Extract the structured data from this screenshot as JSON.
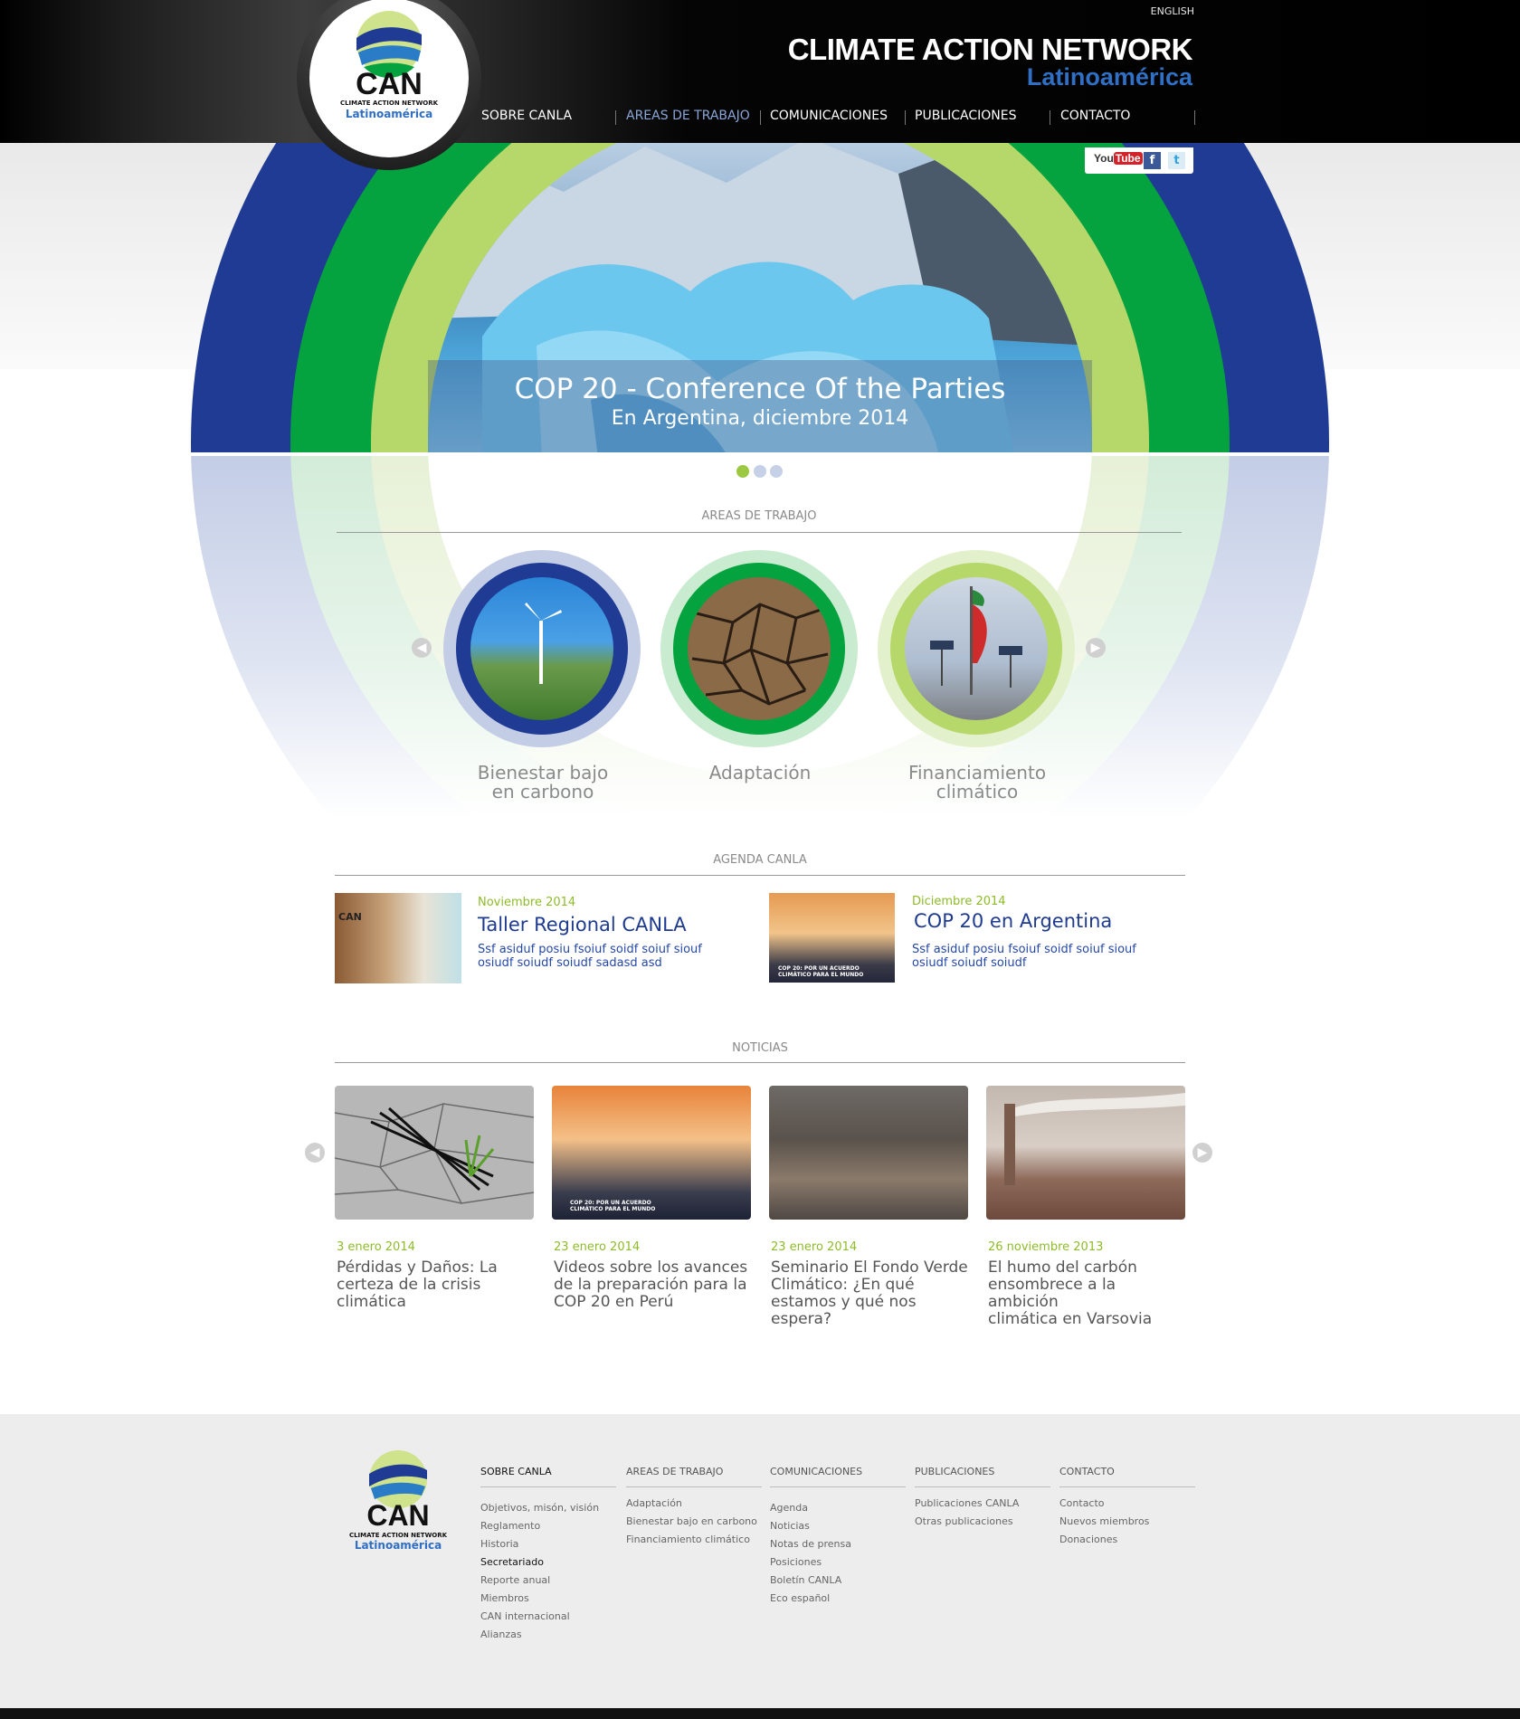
{
  "header": {
    "language_link": "ENGLISH",
    "brand_title": "CLIMATE ACTION NETWORK",
    "brand_subtitle": "Latinoamérica",
    "logo_text": "CAN",
    "logo_line1": "CLIMATE ACTION NETWORK",
    "logo_line2": "Latinoamérica",
    "nav": [
      {
        "label": "SOBRE CANLA",
        "active": false
      },
      {
        "label": "AREAS DE TRABAJO",
        "active": true
      },
      {
        "label": "COMUNICACIONES",
        "active": false
      },
      {
        "label": "PUBLICACIONES",
        "active": false
      },
      {
        "label": "CONTACTO",
        "active": false
      }
    ]
  },
  "social": {
    "youtube": "YouTube",
    "facebook": "f",
    "twitter": "t"
  },
  "hero": {
    "title": "COP 20 - Conference Of the Parties",
    "subtitle": "En Argentina, diciembre 2014",
    "slides": 3,
    "active_slide": 1
  },
  "areas": {
    "section_title": "AREAS DE TRABAJO",
    "items": [
      {
        "label_line1": "Bienestar bajo",
        "label_line2": "en carbono"
      },
      {
        "label_line1": "Adaptación",
        "label_line2": ""
      },
      {
        "label_line1": "Financiamiento",
        "label_line2": "climático"
      }
    ]
  },
  "agenda": {
    "section_title": "AGENDA CANLA",
    "items": [
      {
        "date": "Noviembre 2014",
        "title": "Taller Regional CANLA",
        "text_line1": "Ssf asiduf posiu fsoiuf soidf soiuf siouf",
        "text_line2": "osiudf soiudf soiudf sadasd asd",
        "image_caption": "CAN"
      },
      {
        "date": "Diciembre 2014",
        "title": "COP 20 en Argentina",
        "text_line1": "Ssf asiduf posiu fsoiuf soidf soiuf siouf",
        "text_line2": "osiudf soiudf soiudf",
        "image_caption": "COP 20: POR UN ACUERDO CLIMÁTICO PARA EL MUNDO"
      }
    ]
  },
  "news": {
    "section_title": "NOTICIAS",
    "items": [
      {
        "date": "3 enero 2014",
        "title_line1": "Pérdidas y Daños: La",
        "title_line2": "certeza de la crisis",
        "title_line3": "climática"
      },
      {
        "date": "23 enero 2014",
        "title_line1": "Videos sobre los avances",
        "title_line2": "de la preparación para la",
        "title_line3": "COP 20 en Perú",
        "image_caption": "COP 20: POR UN ACUERDO CLIMÁTICO PARA EL MUNDO"
      },
      {
        "date": "23 enero 2014",
        "title_line1": "Seminario El Fondo Verde",
        "title_line2": "Climático: ¿En qué",
        "title_line3": "estamos y qué nos espera?"
      },
      {
        "date": "26 noviembre 2013",
        "title_line1": "El humo del carbón",
        "title_line2": "ensombrece a la ambición",
        "title_line3": "climática en Varsovia"
      }
    ]
  },
  "footer": {
    "columns": [
      {
        "heading": "SOBRE CANLA",
        "active": true,
        "links": [
          "Objetivos, misón, visión",
          "Reglamento",
          "Historia",
          "Secretariado",
          "Reporte anual",
          "Miembros",
          "CAN internacional",
          "Alianzas"
        ],
        "active_link": 3
      },
      {
        "heading": "AREAS DE TRABAJO",
        "active": false,
        "links": [
          "Adaptación",
          "Bienestar bajo en carbono",
          "Financiamiento climático"
        ]
      },
      {
        "heading": "COMUNICACIONES",
        "active": false,
        "links": [
          "Agenda",
          "Noticias",
          "Notas de prensa",
          "Posiciones",
          "Boletín CANLA",
          "Eco español"
        ]
      },
      {
        "heading": "PUBLICACIONES",
        "active": false,
        "links": [
          "Publicaciones CANLA",
          "Otras publicaciones"
        ]
      },
      {
        "heading": "CONTACTO",
        "active": false,
        "links": [
          "Contacto",
          "Nuevos miembros",
          "Donaciones"
        ]
      }
    ]
  },
  "colors": {
    "blue": "#1f3b94",
    "green": "#05a33f",
    "lime": "#b6d86a",
    "date_green": "#8dbb2a",
    "brand_blue": "#2f6fc4"
  }
}
